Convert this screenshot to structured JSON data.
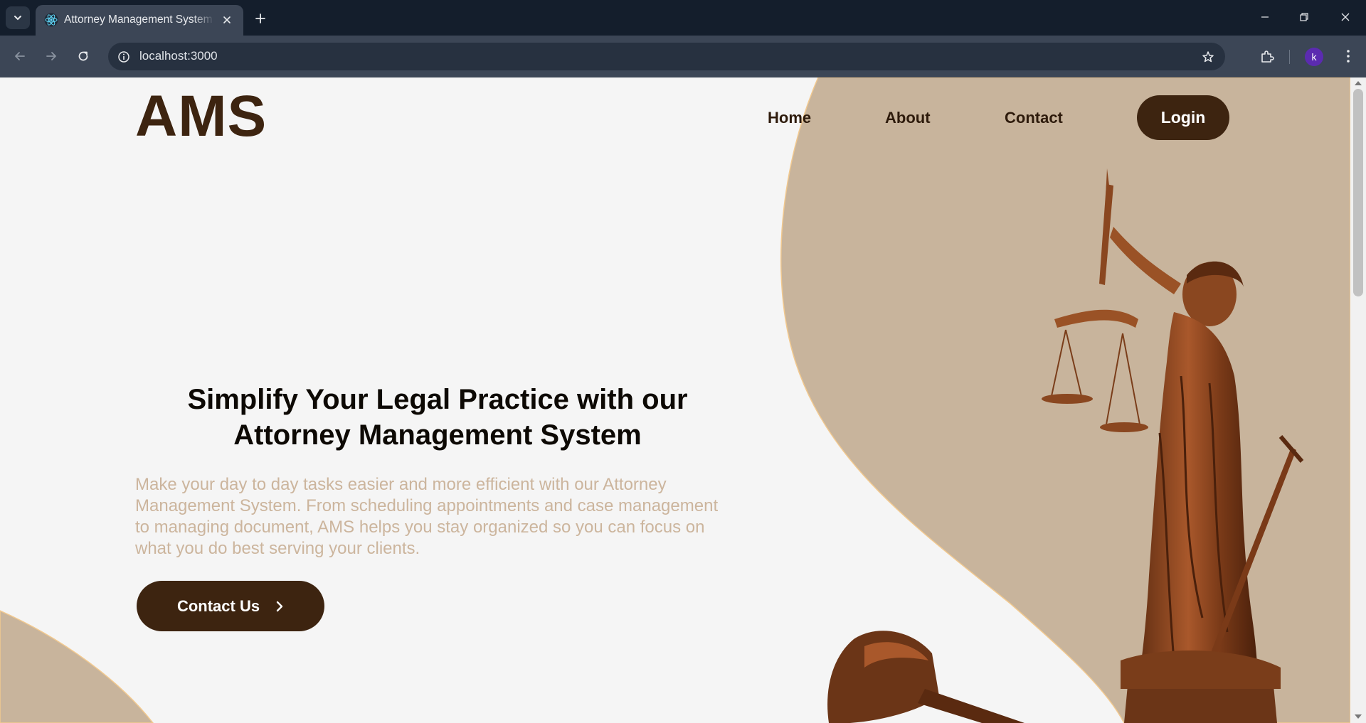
{
  "browser": {
    "tab_title": "Attorney Management System (",
    "url": "localhost:3000",
    "profile_initial": "k"
  },
  "nav": {
    "logo": "AMS",
    "links": [
      "Home",
      "About",
      "Contact"
    ],
    "login_label": "Login"
  },
  "hero": {
    "title_line1": "Simplify Your Legal Practice with our",
    "title_line2": "Attorney Management System",
    "description": "Make your day to day tasks easier and more efficient with our Attorney Management System. From scheduling appointments and case management to managing document, AMS helps you stay organized so you can focus on what you do best serving your clients.",
    "cta_label": "Contact Us"
  },
  "colors": {
    "brand_brown": "#3d2410",
    "accent_tan": "#c8b49c",
    "text_tan": "#ccb59d",
    "browser_dark": "#141e2c"
  },
  "icons": [
    "react-favicon-icon",
    "close-icon",
    "plus-icon",
    "back-arrow-icon",
    "forward-arrow-icon",
    "reload-icon",
    "info-icon",
    "star-icon",
    "extensions-icon",
    "kebab-menu-icon",
    "chevron-right-icon",
    "scales-of-justice-statue-icon",
    "gavel-icon"
  ]
}
